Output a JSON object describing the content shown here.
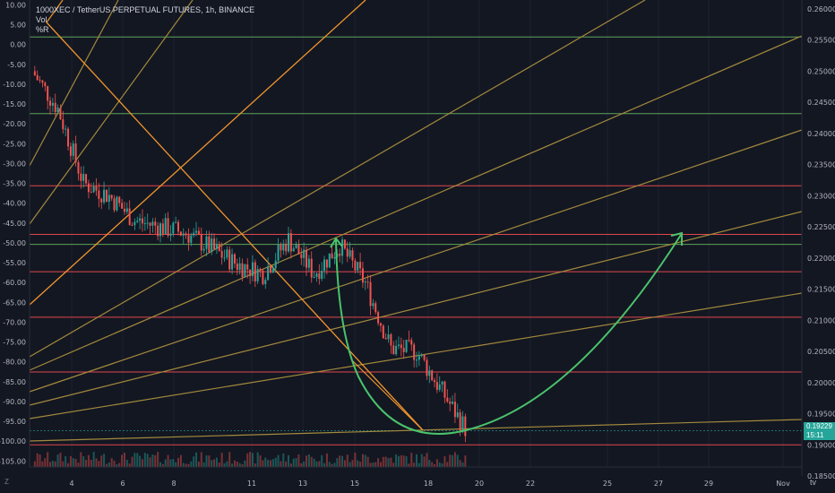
{
  "header": {
    "title": "1000XEC / TetherUS PERPETUAL FUTURES, 1h, BINANCE",
    "vol_label": "Vol",
    "pr_label": "%R"
  },
  "price_badge": {
    "price": "0.19229",
    "countdown": "15:11"
  },
  "icons": {
    "corner": "Z",
    "logo": "tv"
  },
  "colors": {
    "background": "#131722",
    "fib_line": "#a38a3c",
    "fib_line_bright": "#c8a84a",
    "orange": "#f0952d",
    "red_level": "#e0474c",
    "green_level": "#5ea35a",
    "arrow": "#4ac36b",
    "candle_up": "#26a69a",
    "candle_down": "#ef5350"
  },
  "chart_data": {
    "type": "line",
    "title": "1000XEC / TetherUS PERPETUAL FUTURES, 1h, BINANCE",
    "x_tick_labels": [
      "4",
      "6",
      "8",
      "11",
      "13",
      "15",
      "18",
      "20",
      "22",
      "25",
      "27",
      "29",
      "Nov"
    ],
    "right_axis": {
      "ticks": [
        "0.26000",
        "0.25500",
        "0.25000",
        "0.24500",
        "0.24000",
        "0.23500",
        "0.23000",
        "0.22500",
        "0.22000",
        "0.21500",
        "0.21000",
        "0.20500",
        "0.20000",
        "0.19500",
        "0.19000",
        "0.18500"
      ],
      "ylim": [
        0.185,
        0.26
      ]
    },
    "left_axis": {
      "ticks": [
        "10.00",
        "5.00",
        "0.00",
        "-5.00",
        "-10.00",
        "-15.00",
        "-20.00",
        "-25.00",
        "-30.00",
        "-35.00",
        "-40.00",
        "-45.00",
        "-50.00",
        "-55.00",
        "-60.00",
        "-65.00",
        "-70.00",
        "-75.00",
        "-80.00",
        "-85.00",
        "-90.00",
        "-95.00",
        "-100.00",
        "-105.00"
      ],
      "ylim": [
        -106.5,
        11
      ]
    },
    "horizontal_levels": [
      {
        "price": 0.2555,
        "color": "green"
      },
      {
        "price": 0.2432,
        "color": "green"
      },
      {
        "price": 0.2316,
        "color": "red"
      },
      {
        "price": 0.2238,
        "color": "red"
      },
      {
        "price": 0.2222,
        "color": "green"
      },
      {
        "price": 0.2178,
        "color": "red"
      },
      {
        "price": 0.2105,
        "color": "red"
      },
      {
        "price": 0.2017,
        "color": "red"
      },
      {
        "price": 0.19,
        "color": "red"
      }
    ],
    "price_series": {
      "x": [
        "Oct 2",
        "Oct 3",
        "Oct 4",
        "Oct 5",
        "Oct 6",
        "Oct 7",
        "Oct 8",
        "Oct 9",
        "Oct 10",
        "Oct 11",
        "Oct 12",
        "Oct 13",
        "Oct 14",
        "Oct 15",
        "Oct 16",
        "Oct 17",
        "Oct 18",
        "Oct 19"
      ],
      "y": [
        0.25,
        0.244,
        0.232,
        0.23,
        0.226,
        0.225,
        0.224,
        0.2215,
        0.219,
        0.2175,
        0.223,
        0.2175,
        0.222,
        0.216,
        0.2055,
        0.205,
        0.1985,
        0.192
      ]
    },
    "current_price": 0.19229
  }
}
